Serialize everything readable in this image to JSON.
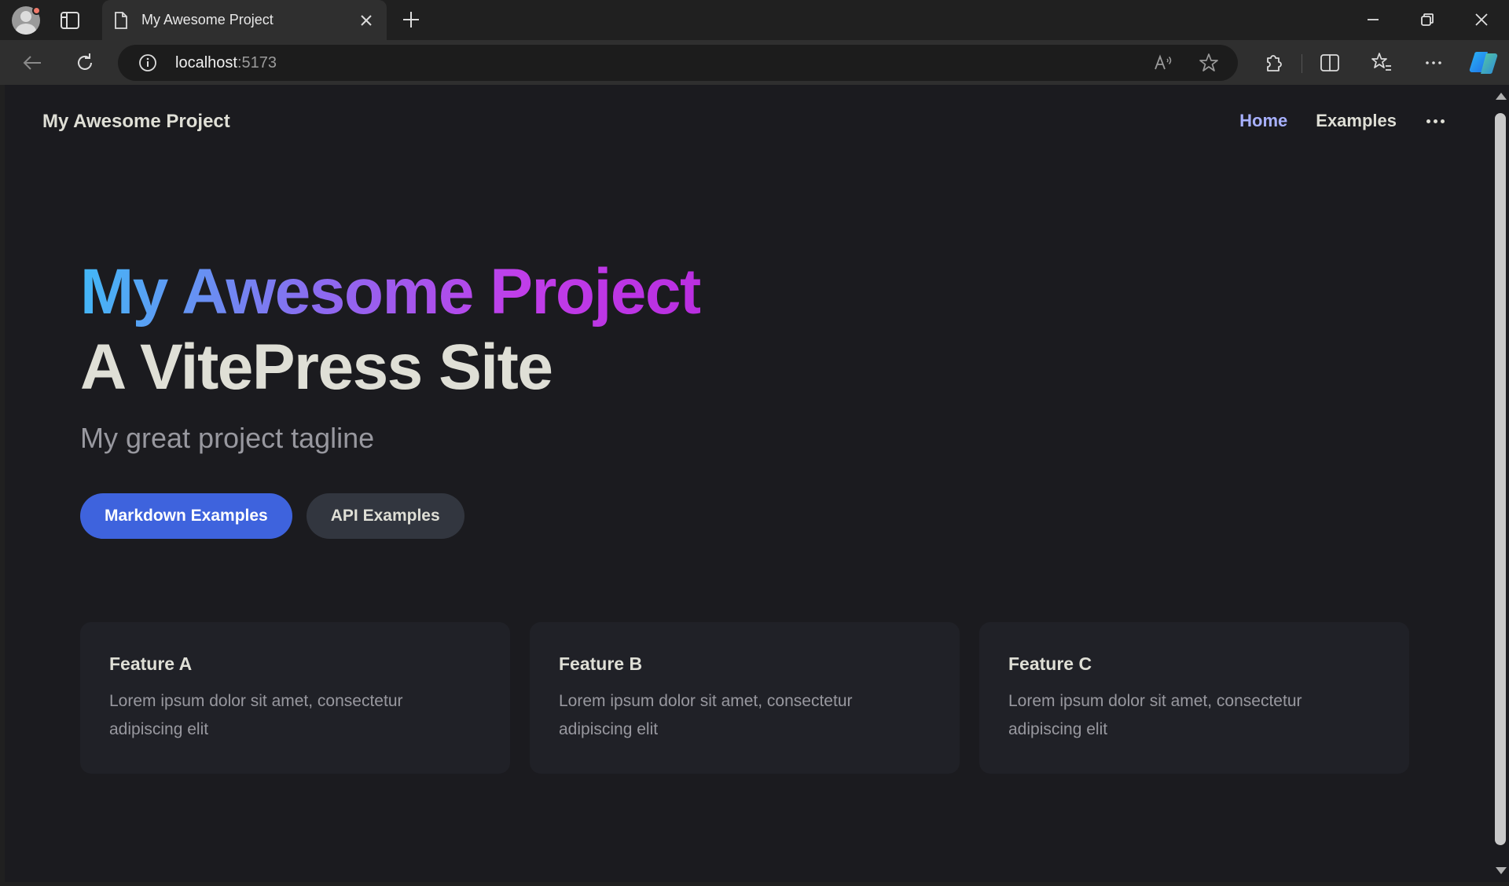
{
  "browser": {
    "tab_title": "My Awesome Project",
    "url_host": "localhost",
    "url_port": ":5173"
  },
  "nav": {
    "brand": "My Awesome Project",
    "links": [
      {
        "label": "Home",
        "active": true
      },
      {
        "label": "Examples",
        "active": false
      }
    ]
  },
  "hero": {
    "name": "My Awesome Project",
    "text": "A VitePress Site",
    "tagline": "My great project tagline",
    "actions": [
      {
        "label": "Markdown Examples",
        "theme": "brand"
      },
      {
        "label": "API Examples",
        "theme": "alt"
      }
    ]
  },
  "features": [
    {
      "title": "Feature A",
      "details": "Lorem ipsum dolor sit amet, consectetur adipiscing elit"
    },
    {
      "title": "Feature B",
      "details": "Lorem ipsum dolor sit amet, consectetur adipiscing elit"
    },
    {
      "title": "Feature C",
      "details": "Lorem ipsum dolor sit amet, consectetur adipiscing elit"
    }
  ],
  "colors": {
    "brand_link": "#a8b1ff",
    "brand_button": "#3e63dd",
    "gradient_start": "#41b9f6",
    "gradient_end": "#c03ee9"
  }
}
